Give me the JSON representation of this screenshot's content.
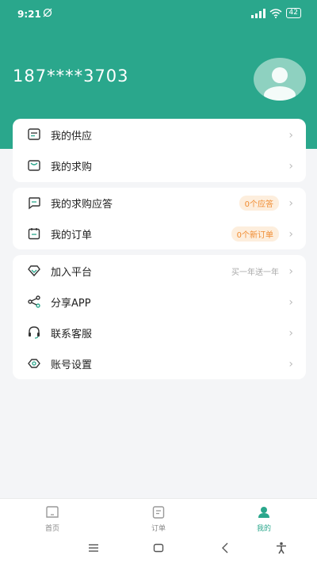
{
  "status": {
    "time": "9:21",
    "battery": "42"
  },
  "profile": {
    "phone": "187****3703"
  },
  "card1": [
    {
      "label": "我的供应"
    },
    {
      "label": "我的求购"
    }
  ],
  "card2": [
    {
      "label": "我的求购应答",
      "badge": "0个应答"
    },
    {
      "label": "我的订单",
      "badge": "0个新订单"
    }
  ],
  "card3": [
    {
      "label": "加入平台",
      "hint": "买一年送一年"
    },
    {
      "label": "分享APP"
    },
    {
      "label": "联系客服"
    },
    {
      "label": "账号设置"
    }
  ],
  "chevron": "›",
  "tabs": [
    {
      "label": "首页",
      "icon": "home-icon"
    },
    {
      "label": "订单",
      "icon": "order-icon"
    },
    {
      "label": "我的",
      "icon": "profile-icon",
      "active": true
    }
  ],
  "colors": {
    "brand": "#2aa78c",
    "badge_text": "#f08c32",
    "badge_bg": "#fdeedd"
  }
}
